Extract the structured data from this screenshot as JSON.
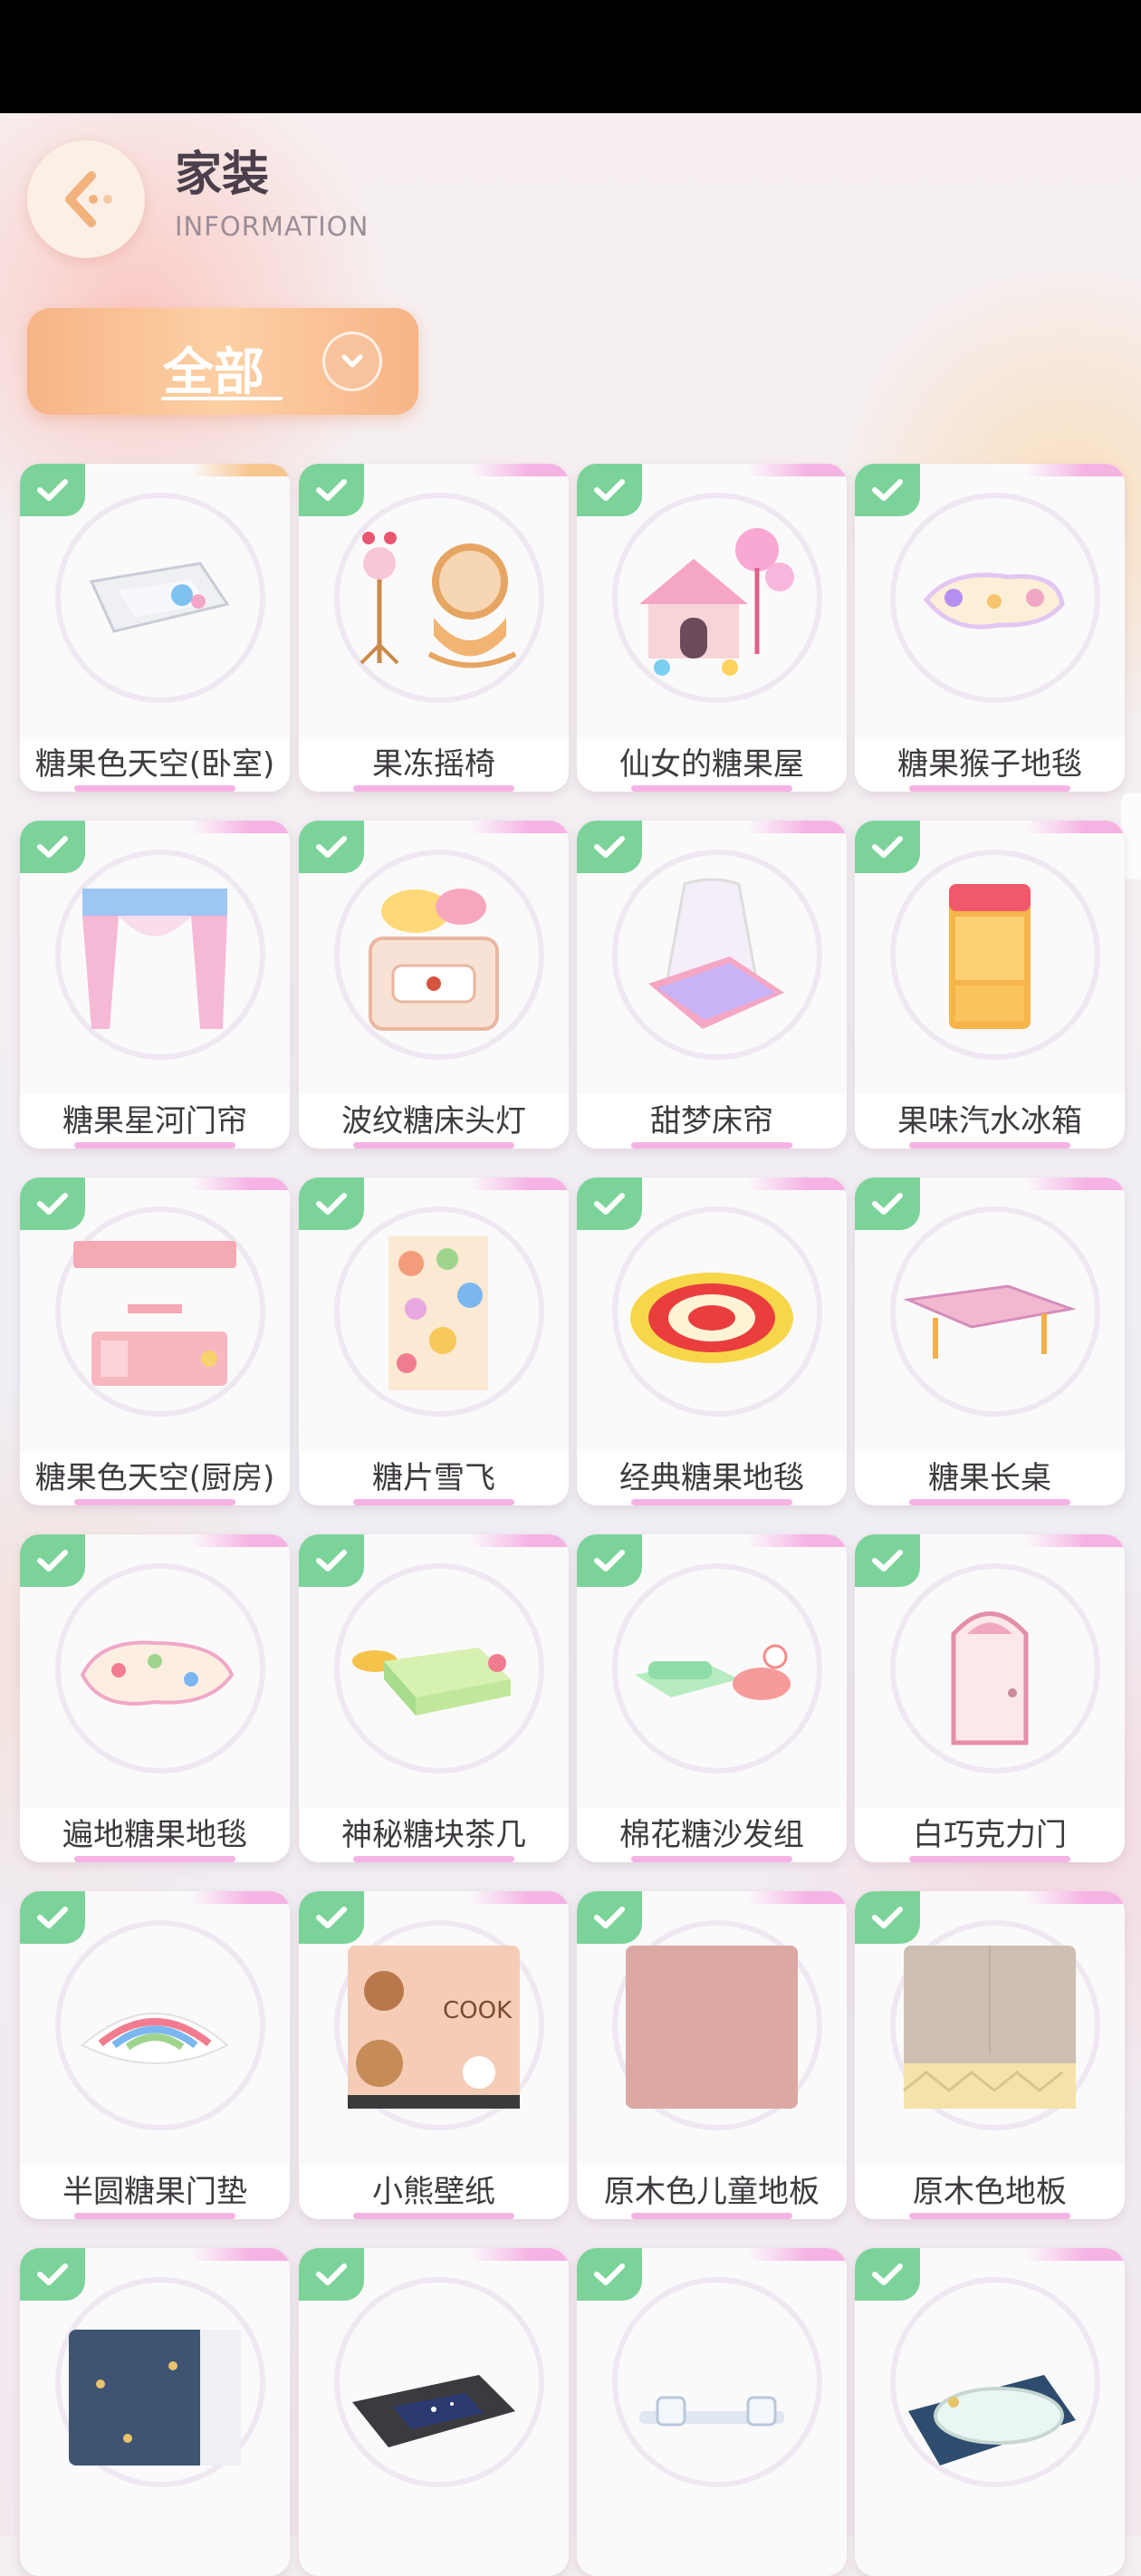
{
  "header": {
    "title": "家装",
    "subtitle": "INFORMATION"
  },
  "filter": {
    "selected": "全部"
  },
  "items": [
    {
      "label": "糖果色天空(卧室)",
      "icon": "ceiling-panel"
    },
    {
      "label": "果冻摇椅",
      "icon": "rocking-chair"
    },
    {
      "label": "仙女的糖果屋",
      "icon": "candy-house"
    },
    {
      "label": "糖果猴子地毯",
      "icon": "monkey-rug"
    },
    {
      "label": "糖果星河门帘",
      "icon": "curtain"
    },
    {
      "label": "波纹糖床头灯",
      "icon": "bedside-lamp"
    },
    {
      "label": "甜梦床帘",
      "icon": "canopy-bed"
    },
    {
      "label": "果味汽水冰箱",
      "icon": "fridge"
    },
    {
      "label": "糖果色天空(厨房)",
      "icon": "kitchen-set"
    },
    {
      "label": "糖片雪飞",
      "icon": "candy-wallpaper"
    },
    {
      "label": "经典糖果地毯",
      "icon": "swirl-rug"
    },
    {
      "label": "糖果长桌",
      "icon": "long-table"
    },
    {
      "label": "遍地糖果地毯",
      "icon": "candy-rug"
    },
    {
      "label": "神秘糖块茶几",
      "icon": "tea-table"
    },
    {
      "label": "棉花糖沙发组",
      "icon": "sofa-set"
    },
    {
      "label": "白巧克力门",
      "icon": "door"
    },
    {
      "label": "半圆糖果门垫",
      "icon": "doormat"
    },
    {
      "label": "小熊壁纸",
      "icon": "bear-wallpaper"
    },
    {
      "label": "原木色儿童地板",
      "icon": "kids-floor"
    },
    {
      "label": "原木色地板",
      "icon": "wood-floor"
    },
    {
      "label": "",
      "icon": "star-floor"
    },
    {
      "label": "",
      "icon": "starry-ceiling"
    },
    {
      "label": "",
      "icon": "wall-shelf"
    },
    {
      "label": "",
      "icon": "bathtub"
    }
  ],
  "bear_wallpaper_text": "COOK"
}
